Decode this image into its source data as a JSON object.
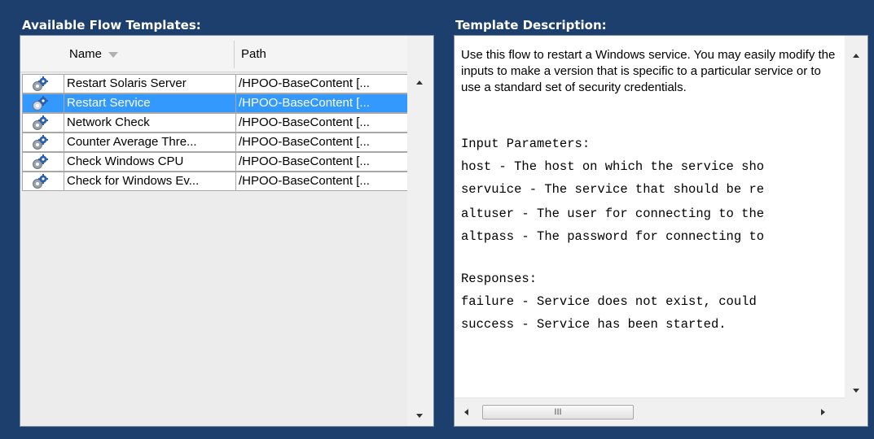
{
  "left_panel": {
    "title": "Available Flow Templates:",
    "columns": {
      "name": "Name",
      "path": "Path"
    },
    "rows": [
      {
        "name": "Restart Solaris Server",
        "path": "/HPOO-BaseContent [...",
        "icon": "gear-flow-icon",
        "selected": false
      },
      {
        "name": "Restart Service",
        "path": "/HPOO-BaseContent [...",
        "icon": "gear-flow-icon",
        "selected": true
      },
      {
        "name": "Network Check",
        "path": "/HPOO-BaseContent [...",
        "icon": "gear-flow-icon",
        "selected": false
      },
      {
        "name": "Counter Average Thre...",
        "path": "/HPOO-BaseContent [...",
        "icon": "gear-flow-icon",
        "selected": false
      },
      {
        "name": "Check Windows CPU",
        "path": "/HPOO-BaseContent [...",
        "icon": "gear-flow-icon",
        "selected": false
      },
      {
        "name": "Check for Windows Ev...",
        "path": "/HPOO-BaseContent [...",
        "icon": "gear-flow-icon",
        "selected": false
      }
    ]
  },
  "right_panel": {
    "title": "Template Description:",
    "intro": "Use this flow to restart a Windows service. You may easily modify the inputs to make a version that is specific to a particular service or to use a standard set of security credentials.",
    "lines": [
      "Input Parameters:",
      "host - The host on which the service sho",
      "servuice - The service that should be re",
      "altuser - The user for connecting to the",
      "altpass - The password for connecting to",
      "",
      "Responses:",
      "failure - Service does not exist, could",
      "success - Service has been started."
    ],
    "hscroll_thumb_grip": "III"
  },
  "colors": {
    "background": "#1d3f6e",
    "selection": "#3399ff"
  }
}
